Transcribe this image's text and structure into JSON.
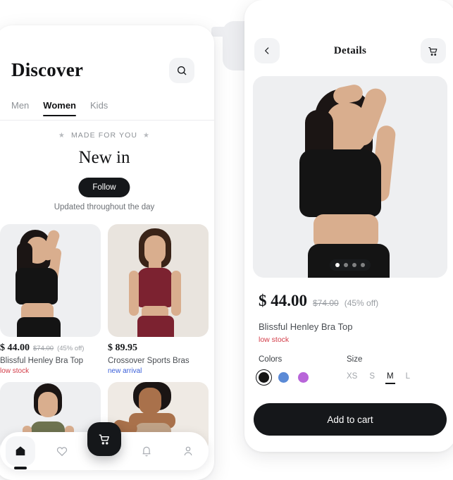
{
  "discover": {
    "title": "Discover",
    "search_icon": "search-icon",
    "tabs": [
      {
        "label": "Men",
        "active": false
      },
      {
        "label": "Women",
        "active": true
      },
      {
        "label": "Kids",
        "active": false
      }
    ],
    "made_for_you": "MADE FOR YOU",
    "star_glyph": "★",
    "section_title": "New in",
    "follow_label": "Follow",
    "updated_note": "Updated throughout the day",
    "products": [
      {
        "price": "$ 44.00",
        "old_price": "$74.00",
        "discount": "(45% off)",
        "name": "Blissful Henley Bra Top",
        "tag": "low stock",
        "tag_color": "#d33d49"
      },
      {
        "price": "$ 89.95",
        "old_price": "",
        "discount": "",
        "name": "Crossover Sports Bras",
        "tag": "new arrival",
        "tag_color": "#3a5fd9"
      }
    ],
    "nav": [
      {
        "icon": "home-icon",
        "active": true
      },
      {
        "icon": "heart-icon",
        "active": false
      },
      {
        "icon": "bell-icon",
        "active": false
      },
      {
        "icon": "person-icon",
        "active": false
      }
    ],
    "fab_icon": "cart-icon"
  },
  "details": {
    "back_icon": "chevron-left-icon",
    "title": "Details",
    "cart_icon": "cart-icon",
    "carousel": {
      "total_dots": 4,
      "active_index": 0
    },
    "price": "$ 44.00",
    "old_price": "$74.00",
    "discount": "(45% off)",
    "name": "Blissful Henley Bra Top",
    "stock_tag": "low stock",
    "colors_label": "Colors",
    "colors": [
      {
        "name": "black",
        "hex": "#141414",
        "selected": true
      },
      {
        "name": "blue",
        "hex": "#5b8ad6",
        "selected": false
      },
      {
        "name": "purple",
        "hex": "#b865d9",
        "selected": false
      }
    ],
    "size_label": "Size",
    "sizes": [
      {
        "label": "XS",
        "selected": false
      },
      {
        "label": "S",
        "selected": false
      },
      {
        "label": "M",
        "selected": true
      },
      {
        "label": "L",
        "selected": false
      }
    ],
    "add_to_cart": "Add to cart"
  },
  "theme": {
    "accent_dark": "#15171a",
    "low_stock": "#d33d49",
    "new_arrival": "#3a5fd9",
    "muted": "#9a9ea3"
  }
}
